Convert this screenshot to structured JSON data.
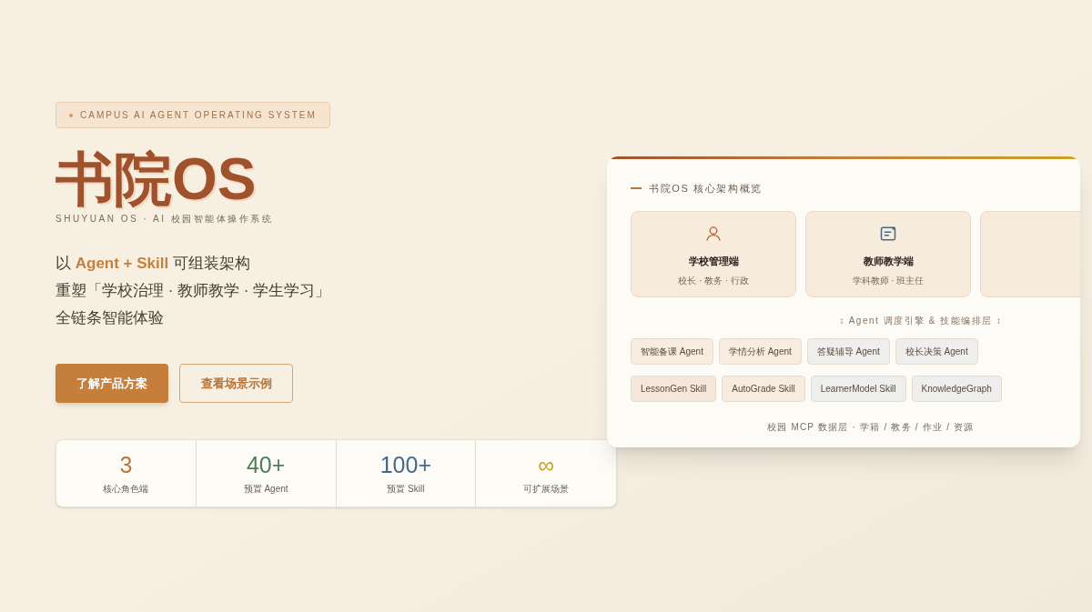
{
  "badge": "CAMPUS AI AGENT OPERATING SYSTEM",
  "title": "书院OS",
  "subtitle": "SHUYUAN OS · AI 校园智能体操作系统",
  "tagline": [
    "以 **Agent + Skill** 可组装架构",
    "重塑「学校治理 · 教师教学 · 学生学习」",
    "全链条智能体验"
  ],
  "buttons": [
    {
      "label": "了解产品方案",
      "kind": "primary"
    },
    {
      "label": "查看场景示例",
      "kind": "outline"
    }
  ],
  "stats": [
    {
      "value": "3",
      "label": "核心角色端",
      "color": "#b9773d"
    },
    {
      "value": "40+",
      "label": "预置 Agent",
      "color": "#4e7d5b"
    },
    {
      "value": "100+",
      "label": "预置 Skill",
      "color": "#46698a"
    },
    {
      "value": "∞",
      "label": "可扩展场景",
      "color": "#c9a227"
    }
  ],
  "panel": {
    "title": "书院OS 核心架构概览",
    "roles": [
      {
        "kind": "admin",
        "name": "学校管理端",
        "members": "校长 · 教务 · 行政"
      },
      {
        "kind": "teacher",
        "name": "教师教学端",
        "members": "学科教师 · 班主任"
      },
      {
        "kind": "hidden"
      }
    ],
    "engine": "↕ Agent 调度引擎 & 技能编排层 ↕",
    "agents": [
      {
        "label": "智能备课 Agent",
        "color": "#f8ece0"
      },
      {
        "label": "学情分析 Agent",
        "color": "#f8ece0"
      },
      {
        "label": "答疑辅导 Agent",
        "color": "#eeeeec"
      },
      {
        "label": "校长决策 Agent",
        "color": "#eeeeec"
      }
    ],
    "skills": [
      {
        "label": "LessonGen Skill",
        "color": "#f5e6dc"
      },
      {
        "label": "AutoGrade Skill",
        "color": "#f8ece0"
      },
      {
        "label": "LearnerModel Skill",
        "color": "#eeeeec"
      },
      {
        "label": "KnowledgeGraph",
        "color": "#eeeeec"
      }
    ],
    "footer": "校园 MCP 数据层 · 学籍 / 教务 / 作业 / 资源"
  }
}
